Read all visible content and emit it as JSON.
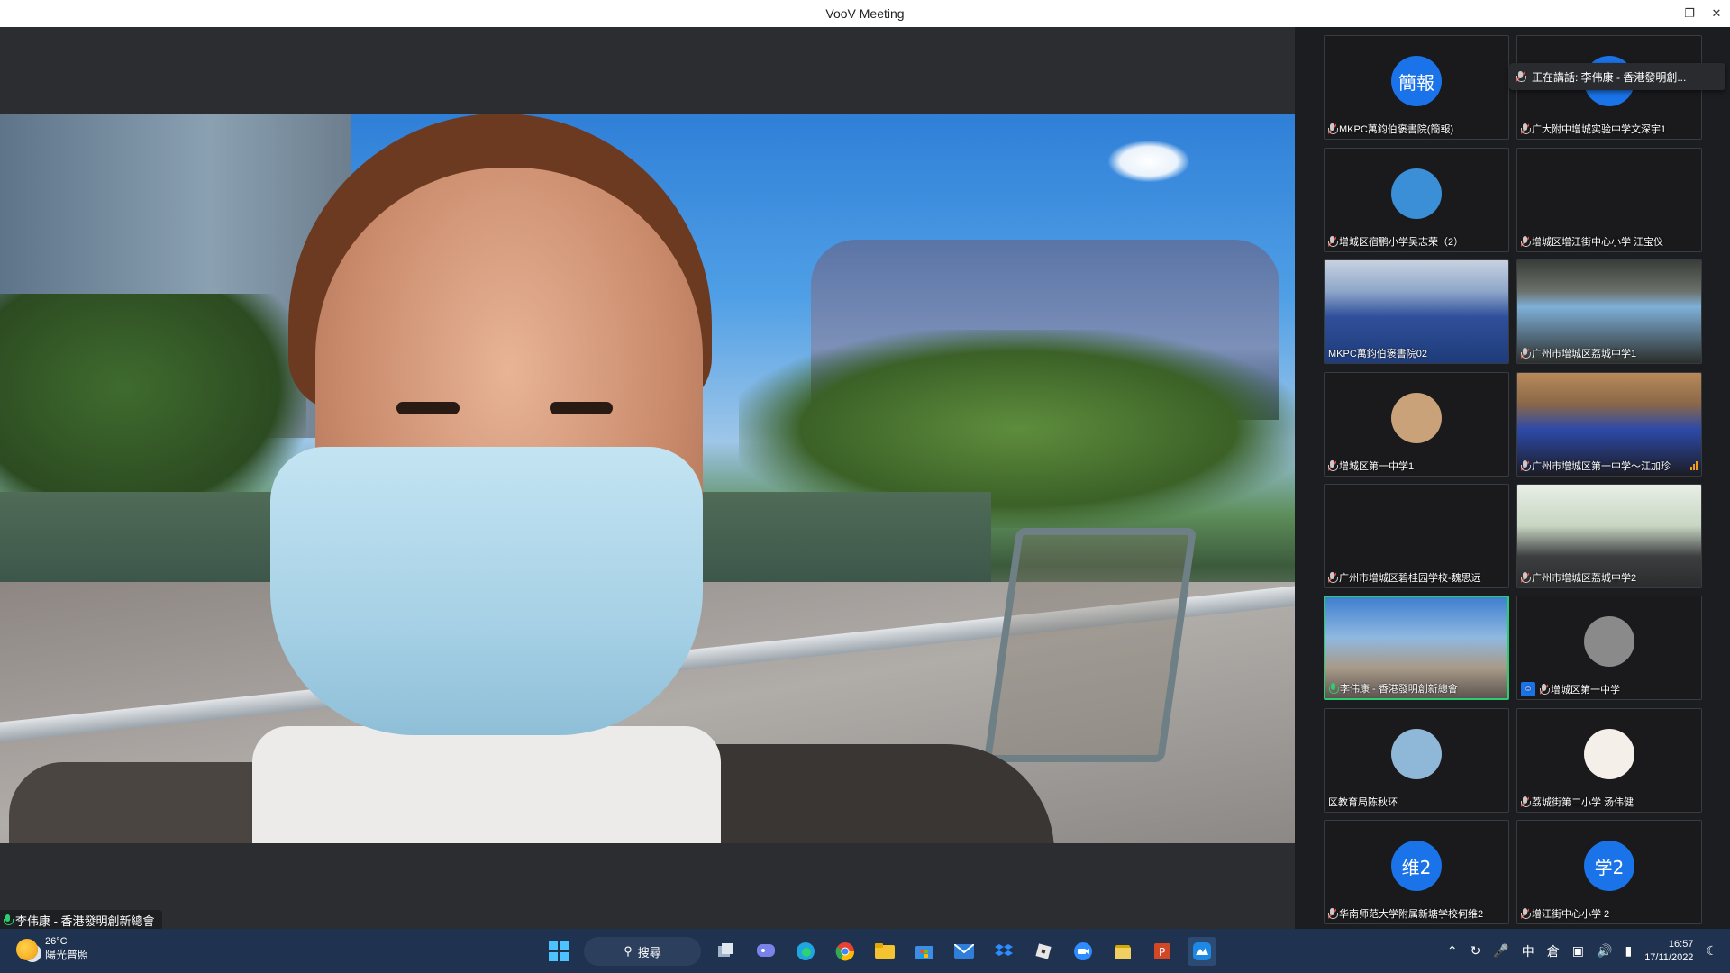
{
  "window": {
    "title": "VooV Meeting"
  },
  "main_speaker": {
    "name": "李伟康 - 香港發明創新總會"
  },
  "speaking_indicator": {
    "text": "正在講話: 李伟康 - 香港發明創..."
  },
  "tiles": [
    {
      "label": "MKPC萬鈞伯褒書院(簡報)",
      "avatar_text": "簡報",
      "avatar_color": "#1a73e8",
      "mic": "muted"
    },
    {
      "label": "广大附中增城实验中学文深宇1",
      "avatar_text": "",
      "avatar_color": "#1a73e8",
      "mic": "muted"
    },
    {
      "label": "增城区宿鹏小学吴志荣（2）",
      "avatar_text": "",
      "avatar_color": "#3a8fd6",
      "mic": "muted"
    },
    {
      "label": "增城区增江街中心小学 江宝仪",
      "avatar_text": "",
      "avatar_color": "",
      "mic": "muted"
    },
    {
      "label": "MKPC萬鈞伯褒書院02",
      "avatar_text": "",
      "avatar_color": "",
      "mic": "none"
    },
    {
      "label": "广州市增城区荔城中学1",
      "avatar_text": "",
      "avatar_color": "",
      "mic": "muted"
    },
    {
      "label": "增城区第一中学1",
      "avatar_text": "",
      "avatar_color": "#c9a27a",
      "mic": "muted"
    },
    {
      "label": "广州市增城区第一中学～江加珍",
      "avatar_text": "",
      "avatar_color": "",
      "mic": "muted"
    },
    {
      "label": "广州市增城区碧桂园学校-魏思远",
      "avatar_text": "",
      "avatar_color": "",
      "mic": "muted"
    },
    {
      "label": "广州市增城区荔城中学2",
      "avatar_text": "",
      "avatar_color": "",
      "mic": "muted"
    },
    {
      "label": "李伟康 - 香港發明創新總會",
      "avatar_text": "",
      "avatar_color": "",
      "mic": "on"
    },
    {
      "label": "增城区第一中学",
      "avatar_text": "",
      "avatar_color": "#8a8a8a",
      "mic": "muted"
    },
    {
      "label": "区教育局陈秋环",
      "avatar_text": "",
      "avatar_color": "#8fb8d8",
      "mic": "none"
    },
    {
      "label": "荔城街第二小学 汤伟健",
      "avatar_text": "",
      "avatar_color": "#f4efe8",
      "mic": "muted"
    },
    {
      "label": "华南师范大学附属新塘学校何维2",
      "avatar_text": "维2",
      "avatar_color": "#1a73e8",
      "mic": "muted"
    },
    {
      "label": "增江街中心小学 2",
      "avatar_text": "学2",
      "avatar_color": "#1a73e8",
      "mic": "muted"
    }
  ],
  "taskbar": {
    "weather_temp": "26°C",
    "weather_desc": "陽光普照",
    "search_label": "搜尋",
    "ime_label": "中",
    "ime_mode": "倉",
    "time": "16:57",
    "date": "17/11/2022",
    "apps": [
      "windows-start",
      "task-view",
      "teams",
      "edge",
      "chrome",
      "file-explorer",
      "store",
      "mail",
      "dropbox",
      "roblox",
      "zoom",
      "edit",
      "powerpoint",
      "voov"
    ]
  }
}
